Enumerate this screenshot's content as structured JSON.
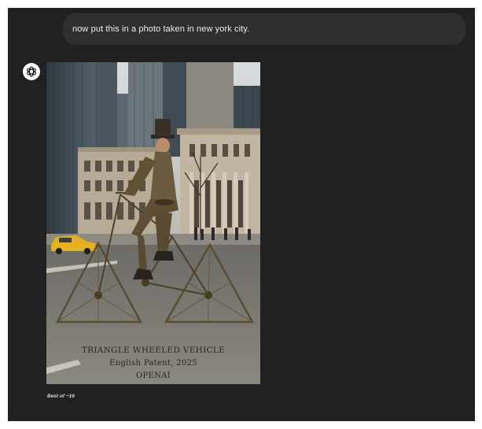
{
  "conversation": {
    "user_message": "now put this in a photo taken in new york city.",
    "assistant": {
      "avatar_icon": "openai-logo-icon",
      "image": {
        "caption_title": "TRIANGLE WHEELED VEHICLE",
        "caption_subtitle": "English Patent, 2025",
        "caption_brand": "OPENAI"
      },
      "variant_label": "Best of ~16"
    }
  },
  "colors": {
    "background": "#212121",
    "user_bubble": "#2f2f2f",
    "text": "#ececec"
  }
}
